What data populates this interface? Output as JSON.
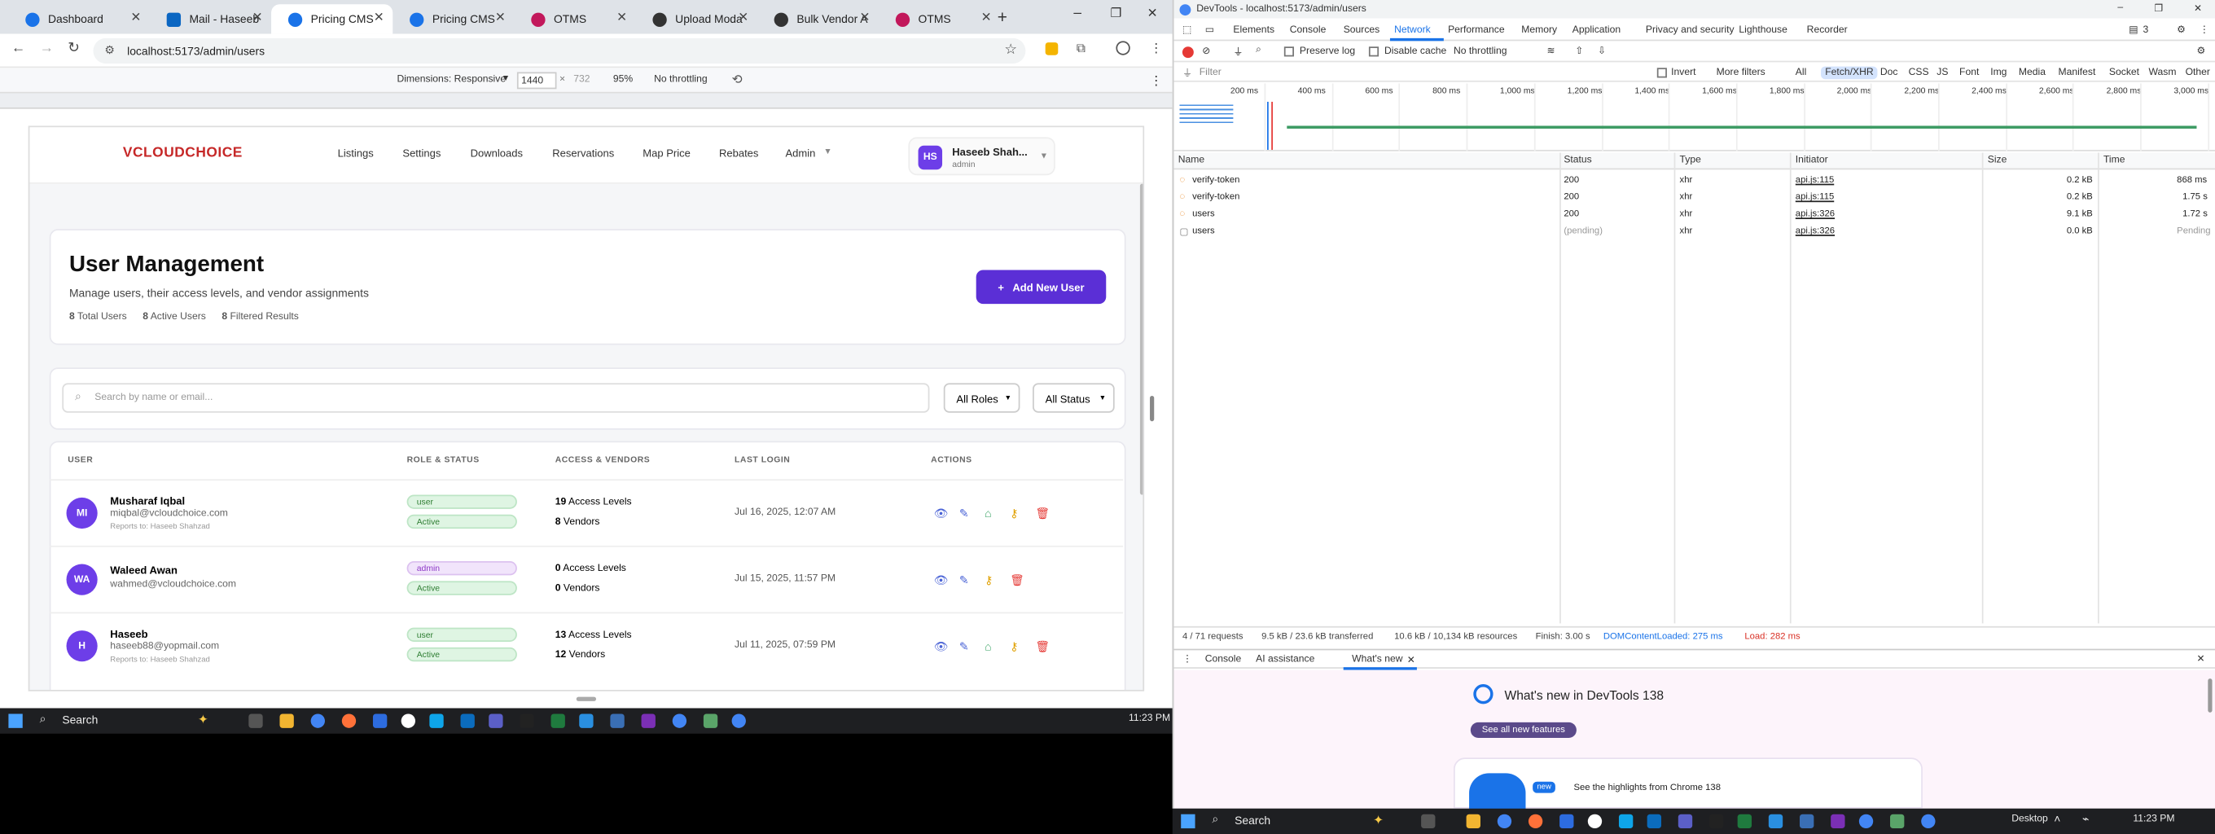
{
  "tabs": [
    {
      "label": "Dashboard",
      "color": "#1a73e8"
    },
    {
      "label": "Mail - Haseeb",
      "color": "#0a66c2"
    },
    {
      "label": "Pricing CMS",
      "color": "#1a73e8"
    },
    {
      "label": "Pricing CMS",
      "color": "#1a73e8"
    },
    {
      "label": "OTMS",
      "color": "#c2185b"
    },
    {
      "label": "Upload Moda",
      "color": "#333333"
    },
    {
      "label": "Bulk Vendor A",
      "color": "#333333"
    },
    {
      "label": "OTMS",
      "color": "#c2185b"
    }
  ],
  "browser": {
    "url": "localhost:5173/admin/users"
  },
  "device_toolbar": {
    "dimensions_label": "Dimensions: Responsive",
    "width": "1440",
    "height": "732",
    "zoom": "95%",
    "throttle": "No throttling"
  },
  "app": {
    "logo": "VCLOUDCHOICE",
    "nav": [
      "Listings",
      "Settings",
      "Downloads",
      "Reservations",
      "Map Price",
      "Rebates",
      "Admin"
    ],
    "user": {
      "initials": "HS",
      "name": "Haseeb Shah...",
      "role": "admin"
    },
    "header": {
      "title": "User Management",
      "subtitle": "Manage users, their access levels, and vendor assignments",
      "stats": [
        {
          "value": "8",
          "label": "Total Users"
        },
        {
          "value": "8",
          "label": "Active Users"
        },
        {
          "value": "8",
          "label": "Filtered Results"
        }
      ],
      "add_button": "Add New User"
    },
    "filters": {
      "search_placeholder": "Search by name or email...",
      "roles": "All Roles",
      "status": "All Status"
    },
    "table": {
      "headers": [
        "USER",
        "ROLE & STATUS",
        "ACCESS & VENDORS",
        "LAST LOGIN",
        "ACTIONS"
      ],
      "rows": [
        {
          "initials": "MI",
          "name": "Musharaf Iqbal",
          "email": "miqbal@vcloudchoice.com",
          "reports": "Reports to: Haseeb Shahzad",
          "role": "user",
          "status": "Active",
          "access_count": "19",
          "access_label": "Access Levels",
          "vendors_count": "8",
          "vendors_label": "Vendors",
          "last_login": "Jul 16, 2025, 12:07 AM"
        },
        {
          "initials": "WA",
          "name": "Waleed Awan",
          "email": "wahmed@vcloudchoice.com",
          "reports": "",
          "role": "admin",
          "status": "Active",
          "access_count": "0",
          "access_label": "Access Levels",
          "vendors_count": "0",
          "vendors_label": "Vendors",
          "last_login": "Jul 15, 2025, 11:57 PM"
        },
        {
          "initials": "H",
          "name": "Haseeb",
          "email": "haseeb88@yopmail.com",
          "reports": "Reports to: Haseeb Shahzad",
          "role": "user",
          "status": "Active",
          "access_count": "13",
          "access_label": "Access Levels",
          "vendors_count": "12",
          "vendors_label": "Vendors",
          "last_login": "Jul 11, 2025, 07:59 PM"
        }
      ]
    }
  },
  "taskbar": {
    "search": "Search",
    "time": "11:23 PM",
    "desktop": "Desktop"
  },
  "devtools": {
    "title": "DevTools - localhost:5173/admin/users",
    "panels": [
      "Elements",
      "Console",
      "Sources",
      "Network",
      "Performance",
      "Memory",
      "Application",
      "Privacy and security",
      "Lighthouse",
      "Recorder"
    ],
    "active_panel": "Network",
    "issues_count": "3",
    "preserve_log": "Preserve log",
    "disable_cache": "Disable cache",
    "throttle": "No throttling",
    "filter_placeholder": "Filter",
    "invert": "Invert",
    "more_filters": "More filters",
    "type_filters": [
      "All",
      "Fetch/XHR",
      "Doc",
      "CSS",
      "JS",
      "Font",
      "Img",
      "Media",
      "Manifest",
      "Socket",
      "Wasm",
      "Other"
    ],
    "timeline_ticks": [
      "200 ms",
      "400 ms",
      "600 ms",
      "800 ms",
      "1,000 ms",
      "1,200 ms",
      "1,400 ms",
      "1,600 ms",
      "1,800 ms",
      "2,000 ms",
      "2,200 ms",
      "2,400 ms",
      "2,600 ms",
      "2,800 ms",
      "3,000 ms"
    ],
    "columns": [
      "Name",
      "Status",
      "Type",
      "Initiator",
      "Size",
      "Time"
    ],
    "requests": [
      {
        "name": "verify-token",
        "status": "200",
        "type": "xhr",
        "initiator": "api.js:115",
        "size": "0.2 kB",
        "time": "868 ms"
      },
      {
        "name": "verify-token",
        "status": "200",
        "type": "xhr",
        "initiator": "api.js:115",
        "size": "0.2 kB",
        "time": "1.75 s"
      },
      {
        "name": "users",
        "status": "200",
        "type": "xhr",
        "initiator": "api.js:326",
        "size": "9.1 kB",
        "time": "1.72 s"
      },
      {
        "name": "users",
        "status": "(pending)",
        "type": "xhr",
        "initiator": "api.js:326",
        "size": "0.0 kB",
        "time": "Pending"
      }
    ],
    "summary": {
      "requests": "4 / 71 requests",
      "transferred": "9.5 kB / 23.6 kB transferred",
      "resources": "10.6 kB / 10,134 kB resources",
      "finish": "Finish: 3.00 s",
      "dcl": "DOMContentLoaded: 275 ms",
      "load": "Load: 282 ms"
    },
    "drawer": {
      "tabs": [
        "Console",
        "AI assistance",
        "What's new"
      ],
      "heading": "What's new in DevTools 138",
      "button": "See all new features",
      "badge": "new",
      "highlight": "See the highlights from Chrome 138"
    }
  }
}
